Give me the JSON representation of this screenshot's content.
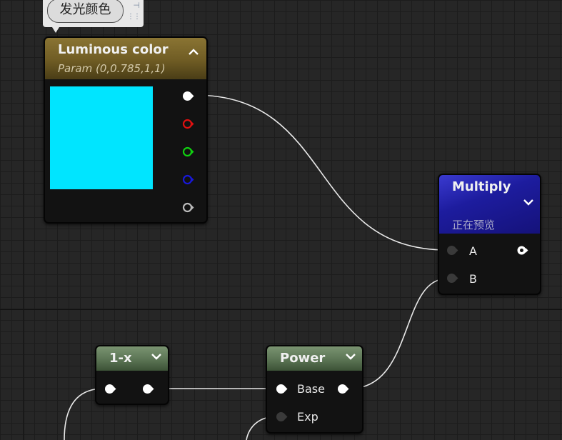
{
  "comment": {
    "text": "发光颜色",
    "pin_icon": "pin-icon",
    "menu_icon": "dots-icon"
  },
  "nodes": {
    "luminous": {
      "title": "Luminous color",
      "subtitle": "Param (0,0.785,1,1)",
      "swatch_color": "#00e5ff",
      "header_color": "#7a6a2e",
      "pins": [
        "rgba",
        "r",
        "g",
        "b",
        "a"
      ],
      "pin_colors": [
        "#ffffff",
        "#e01010",
        "#10d010",
        "#1010d0",
        "#bbbbbb"
      ]
    },
    "multiply": {
      "title": "Multiply",
      "status": "正在预览",
      "header_color": "#1d1c9e",
      "inputs": [
        "A",
        "B"
      ]
    },
    "one_minus": {
      "title": "1-x",
      "header_color": "#5b7454"
    },
    "power": {
      "title": "Power",
      "header_color": "#5b7454",
      "inputs": [
        "Base",
        "Exp"
      ]
    }
  }
}
